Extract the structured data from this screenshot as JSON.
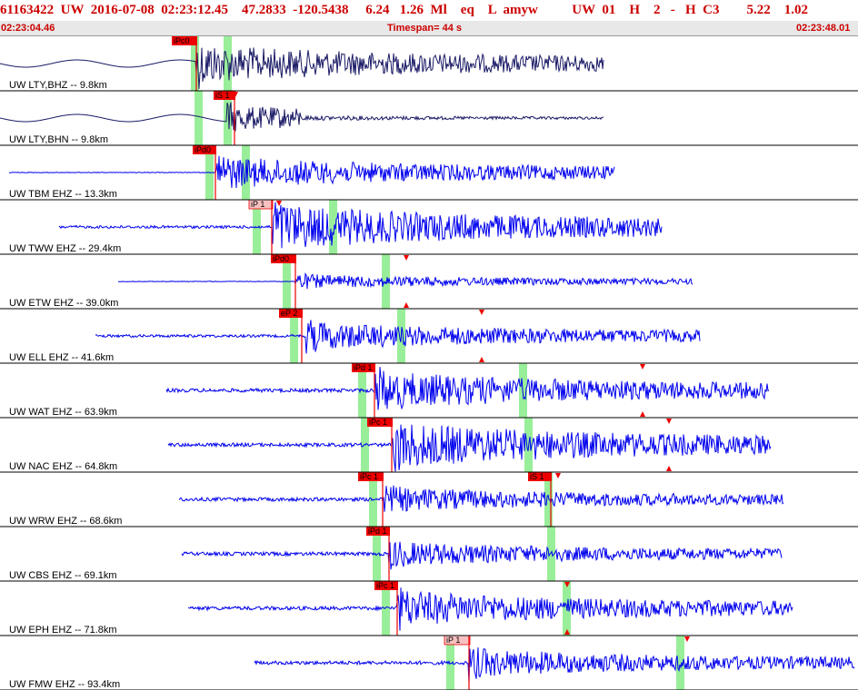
{
  "header": {
    "line1": "61163422  UW  2016-07-08  02:23:12.45    47.2833  -120.5438     6.24   1.26  Ml    eq    L  amyw          UW  01    H    2   -   H  C3        5.22    1.02",
    "start_time": "02:23:04.46",
    "timespan": "Timespan=  44 s",
    "end_time": "02:23:48.01"
  },
  "colors": {
    "header_text": "#cc0000",
    "trace": "#0000ee",
    "trace_dark": "#1a1a66",
    "pick": "#ee0000",
    "pick_light": "#f7c0c0",
    "window": "#99ee99"
  },
  "traces": [
    {
      "label": "UW LTY,BHZ -- 9.8km",
      "color": "dark",
      "pick": "iPc0",
      "pick_light": false
    },
    {
      "label": "UW LTY,BHN -- 9.8km",
      "color": "dark",
      "pick": "iS 1",
      "pick_light": false
    },
    {
      "label": "UW TBM EHZ -- 13.3km",
      "color": "blue",
      "pick": "iPd0",
      "pick_light": false
    },
    {
      "label": "UW TWW EHZ -- 29.4km",
      "color": "blue",
      "pick": "iP 1",
      "pick_light": true
    },
    {
      "label": "UW ETW EHZ -- 39.0km",
      "color": "blue",
      "pick": "iPd0",
      "pick_light": false
    },
    {
      "label": "UW ELL EHZ -- 41.6km",
      "color": "blue",
      "pick": "eP 2",
      "pick_light": false
    },
    {
      "label": "UW WAT EHZ -- 63.9km",
      "color": "blue",
      "pick": "iPd 1",
      "pick_light": false
    },
    {
      "label": "UW NAC EHZ -- 64.8km",
      "color": "blue",
      "pick": "iPc 1",
      "pick_light": false
    },
    {
      "label": "UW WRW EHZ -- 68.6km",
      "color": "blue",
      "pick": "iPc 1",
      "pick_light": false,
      "pick2": "iS 1"
    },
    {
      "label": "UW CBS EHZ -- 69.1km",
      "color": "blue",
      "pick": "iPd 1",
      "pick_light": false
    },
    {
      "label": "UW EPH EHZ -- 71.8km",
      "color": "blue",
      "pick": "iPc 1",
      "pick_light": false
    },
    {
      "label": "UW FMW EHZ -- 93.4km",
      "color": "blue",
      "pick": "iP 1",
      "pick_light": true
    }
  ]
}
